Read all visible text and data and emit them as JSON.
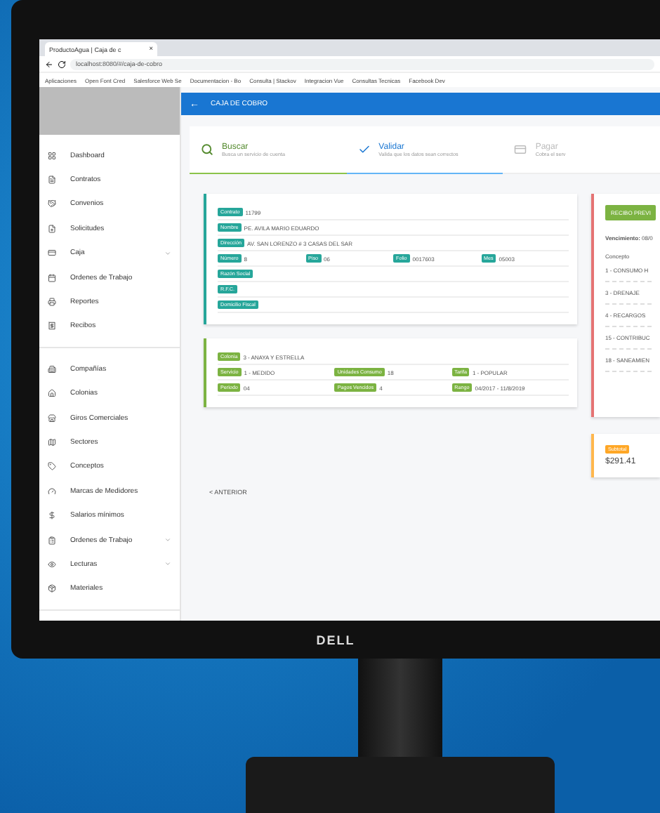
{
  "browser": {
    "tab_title": "ProductoAgua | Caja de c",
    "tab_close": "×",
    "address": "localhost:8080/#/caja-de-cobro",
    "bookmarks": [
      "Aplicaciones",
      "Open Font Cred",
      "Salesforce Web Se",
      "Documentacion - Bo",
      "Consulta | Stackov",
      "Integracion Vue",
      "Consultas Tecnicas",
      "Facebook Dev"
    ]
  },
  "header": {
    "back": "←",
    "title": "CAJA DE COBRO"
  },
  "sidebar": {
    "groups": [
      {
        "items": [
          {
            "label": "Dashboard",
            "expandable": false
          },
          {
            "label": "Contratos",
            "expandable": false
          },
          {
            "label": "Convenios",
            "expandable": false
          },
          {
            "label": "Solicitudes",
            "expandable": false
          },
          {
            "label": "Caja",
            "expandable": true
          },
          {
            "label": "Ordenes de Trabajo",
            "expandable": false
          },
          {
            "label": "Reportes",
            "expandable": false
          },
          {
            "label": "Recibos",
            "expandable": false
          }
        ]
      },
      {
        "items": [
          {
            "label": "Compañías",
            "expandable": false
          },
          {
            "label": "Colonias",
            "expandable": false
          },
          {
            "label": "Giros Comerciales",
            "expandable": false
          },
          {
            "label": "Sectores",
            "expandable": false
          },
          {
            "label": "Conceptos",
            "expandable": false
          },
          {
            "label": "Marcas de Medidores",
            "expandable": false
          },
          {
            "label": "Salarios mínimos",
            "expandable": false
          },
          {
            "label": "Ordenes de Trabajo",
            "expandable": true
          },
          {
            "label": "Lecturas",
            "expandable": true
          },
          {
            "label": "Materiales",
            "expandable": false
          }
        ]
      }
    ]
  },
  "steps": [
    {
      "title": "Buscar",
      "subtitle": "Busca un servicio de cuenta",
      "done": true,
      "selected": false
    },
    {
      "title": "Validar",
      "subtitle": "Valida que los datos sean correctos",
      "done": false,
      "selected": true
    },
    {
      "title": "Pagar",
      "subtitle": "Cobra el serv",
      "done": false,
      "selected": false
    }
  ],
  "account_card": {
    "rows": [
      [
        {
          "label": "Contrato",
          "value": "11799"
        }
      ],
      [
        {
          "label": "Nombre",
          "value": "PE. AVILA MARIO EDUARDO"
        }
      ],
      [
        {
          "label": "Dirección",
          "value": "AV. SAN LORENZO # 3 CASAS DEL SAR"
        }
      ],
      [
        {
          "label": "Número",
          "value": "8"
        },
        {
          "label": "Piso",
          "value": "06"
        },
        {
          "label": "Folio",
          "value": "0017603"
        },
        {
          "label": "Mes",
          "value": "05003"
        }
      ],
      [
        {
          "label": "Razón Social"
        }
      ],
      [
        {
          "label": "R.F.C."
        }
      ],
      [
        {
          "label": "Domicilio Fiscal"
        }
      ]
    ]
  },
  "service_card": {
    "rows": [
      [
        {
          "label": "Colonia",
          "value": "3 - ANAYA Y ESTRELLA"
        }
      ],
      [
        {
          "label": "Servicio",
          "value": "1 - MEDIDO"
        },
        {
          "label": "Unidades Consumo",
          "value": "18"
        },
        {
          "label": "Tarifa",
          "value": "1 - POPULAR"
        }
      ],
      [
        {
          "label": "Periodo",
          "value": "04"
        },
        {
          "label": "Pagos Vencidos",
          "value": "4"
        },
        {
          "label": "Rango",
          "value": "04/2017 - 11/8/2019"
        }
      ]
    ]
  },
  "back_button": "< ANTERIOR",
  "receipt": {
    "button": "RECIBO PREVI",
    "due_label": "Vencimiento:",
    "due_value": "08/0",
    "column": "Concepto",
    "concepts": [
      "1 - CONSUMO H",
      "3 - DRENAJE",
      "4 - RECARGOS",
      "15 - CONTRIBUC",
      "18 - SANEAMIEN"
    ]
  },
  "total": {
    "badge": "Subtotal",
    "amount": "$291.41"
  },
  "monitor": {
    "brand": "DELL"
  }
}
